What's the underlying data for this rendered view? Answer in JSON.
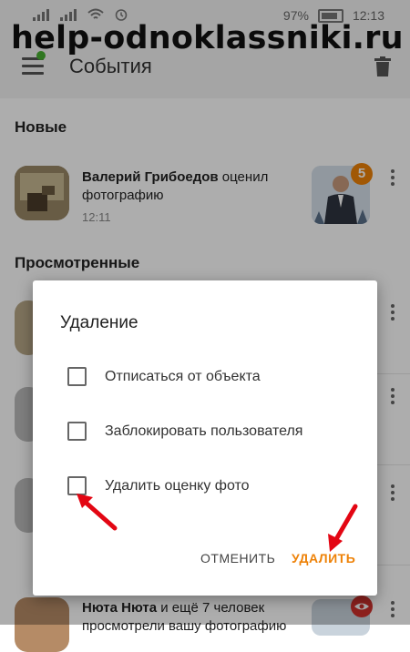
{
  "status_bar": {
    "battery": "97%",
    "time": "12:13"
  },
  "app_bar": {
    "title": "События"
  },
  "watermark": "help-odnoklassniki.ru",
  "sections": {
    "new": "Новые",
    "viewed": "Просмотренные"
  },
  "event": {
    "user": "Валерий Грибоедов",
    "action": "оценил фотографию",
    "time": "12:11",
    "badge": "5"
  },
  "bottom_event": {
    "user": "Нюта Нюта",
    "action": "и ещё 7 человек",
    "line2": "просмотрели вашу фотографию"
  },
  "dialog": {
    "title": "Удаление",
    "options": [
      {
        "label": "Отписаться от объекта",
        "checked": false
      },
      {
        "label": "Заблокировать пользователя",
        "checked": false
      },
      {
        "label": "Удалить оценку фото",
        "checked": false
      }
    ],
    "cancel": "ОТМЕНИТЬ",
    "confirm": "УДАЛИТЬ"
  },
  "colors": {
    "accent": "#ee8208",
    "arrow": "#e30613",
    "online": "#48b031"
  }
}
